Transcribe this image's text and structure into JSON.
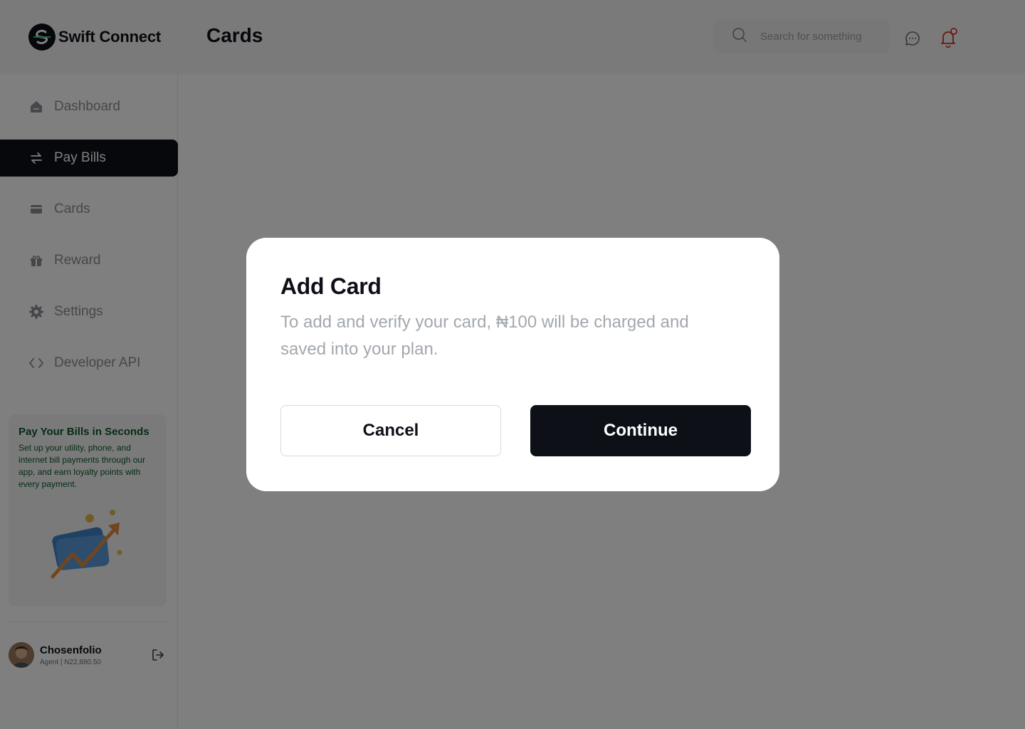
{
  "app": {
    "name": "Swift Connect"
  },
  "header": {
    "page_title": "Cards",
    "search": {
      "placeholder": "Search for something",
      "value": ""
    }
  },
  "sidebar": {
    "items": [
      {
        "label": "Dashboard",
        "icon": "home-icon"
      },
      {
        "label": "Pay Bills",
        "icon": "swap-arrows-icon",
        "active": true
      },
      {
        "label": "Cards",
        "icon": "card-icon"
      },
      {
        "label": "Reward",
        "icon": "gift-icon"
      },
      {
        "label": "Settings",
        "icon": "gear-icon"
      },
      {
        "label": "Developer API",
        "icon": "code-icon"
      }
    ],
    "promo": {
      "title": "Pay Your Bills in Seconds",
      "text": "Set up your utility, phone, and internet bill payments through our app, and earn loyalty points with every payment."
    },
    "user": {
      "name": "Chosenfolio",
      "subtitle": "Agent | N22,880.50"
    }
  },
  "modal": {
    "title": "Add Card",
    "description": "To add and verify your card, ₦100 will be charged and saved into your plan.",
    "cancel_label": "Cancel",
    "continue_label": "Continue"
  },
  "colors": {
    "primary": "#0d1117",
    "promo_text": "#0b5a2a",
    "notification": "#d9302c",
    "muted_text": "#a3a8ae"
  }
}
